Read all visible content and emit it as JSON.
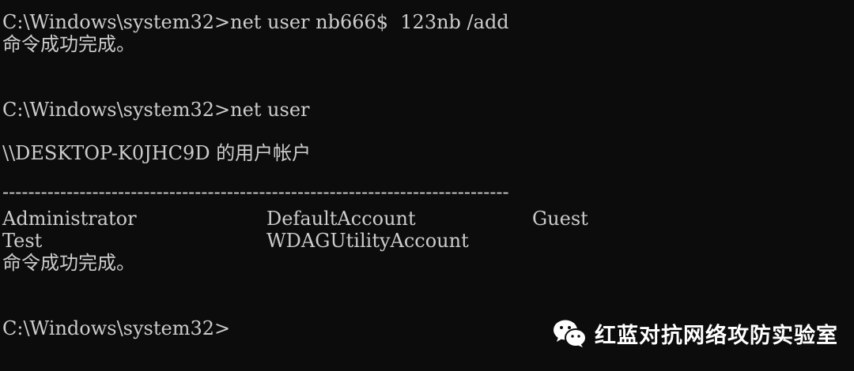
{
  "terminal": {
    "line1": "C:\\Windows\\system32>net user nb666$  123nb /add",
    "line2": "命令成功完成。",
    "line3": "C:\\Windows\\system32>net user",
    "line4": "\\\\DESKTOP-K0JHC9D 的用户帐户",
    "separator": "-------------------------------------------------------------------------------",
    "accounts": [
      [
        "Administrator",
        "DefaultAccount",
        "Guest"
      ],
      [
        "Test",
        "WDAGUtilityAccount",
        ""
      ]
    ],
    "line5": "命令成功完成。",
    "prompt": "C:\\Windows\\system32>"
  },
  "watermark": {
    "icon": "wechat-icon",
    "text": "红蓝对抗网络攻防实验室"
  },
  "colors": {
    "background": "#0c0c0c",
    "text": "#cccccc"
  }
}
